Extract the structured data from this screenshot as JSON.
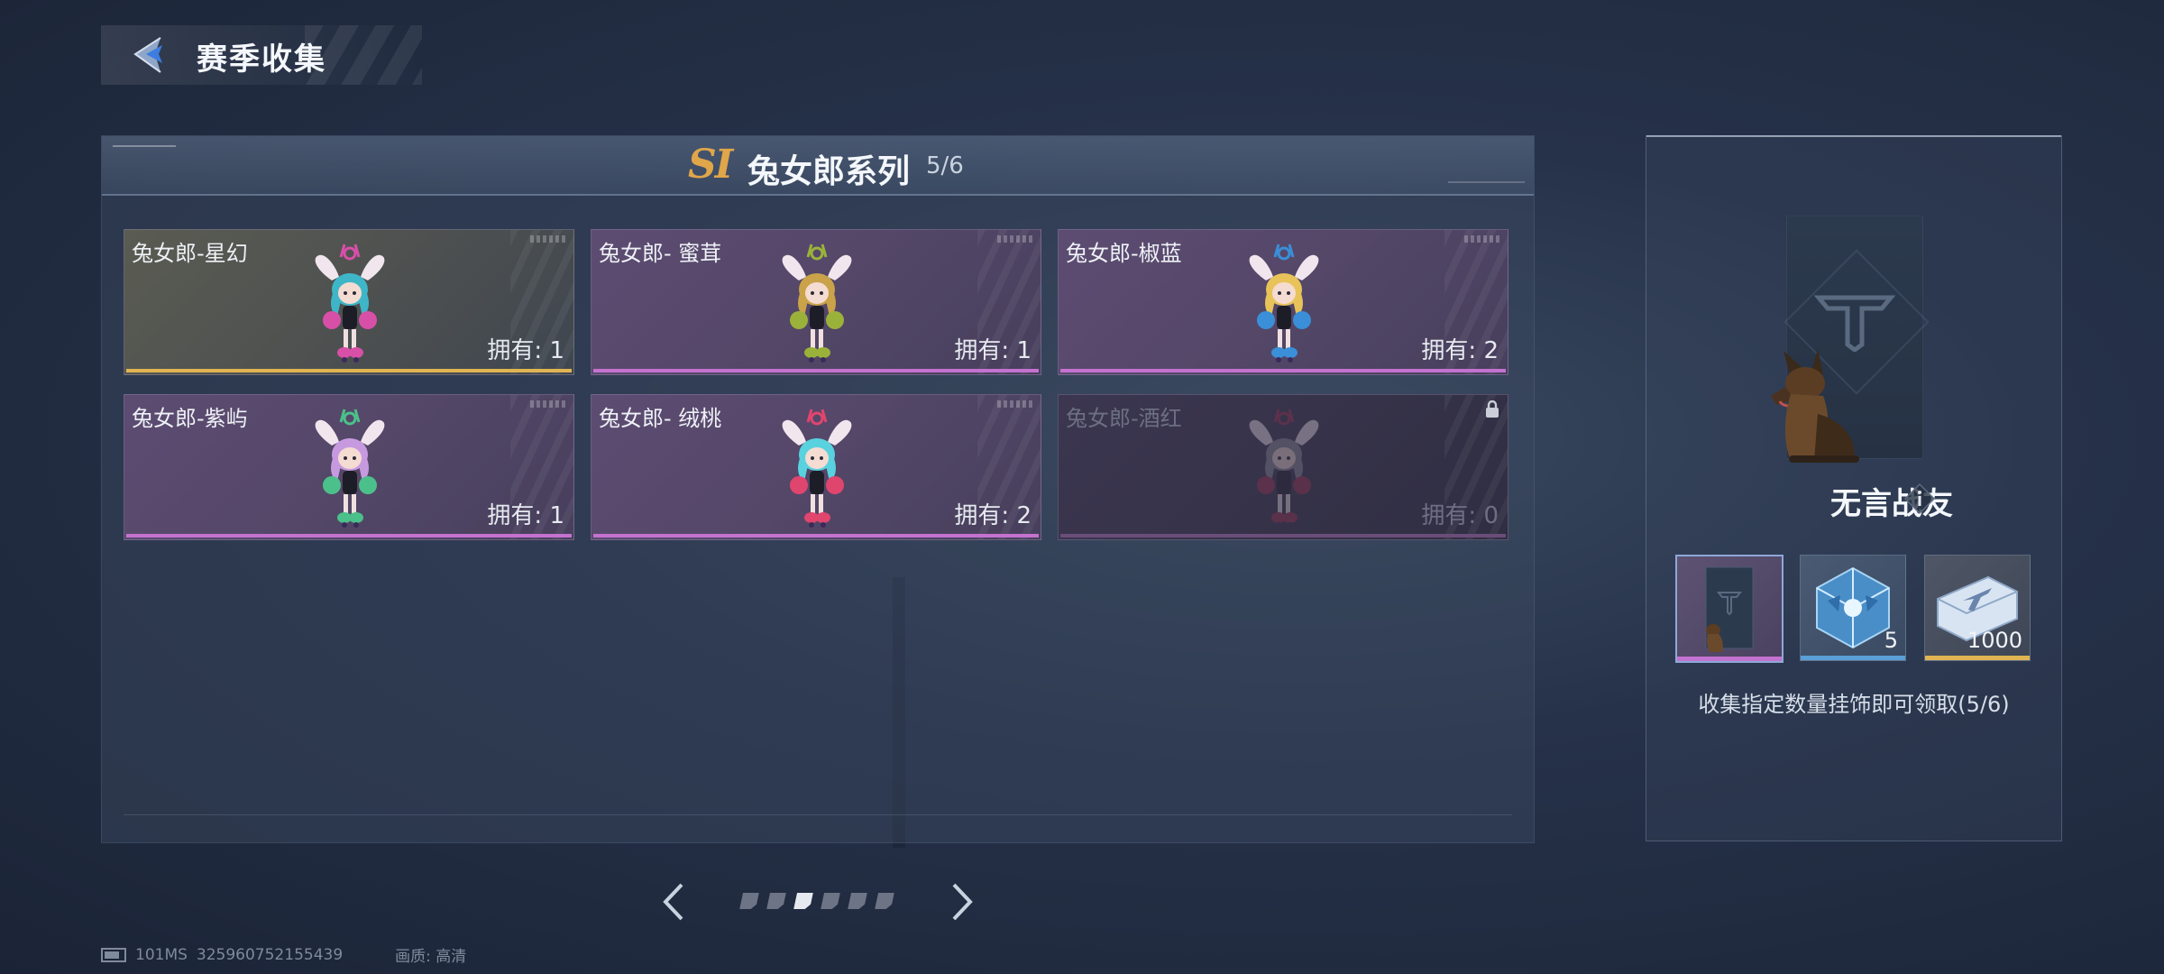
{
  "header": {
    "title": "赛季收集"
  },
  "series": {
    "season_badge": "SI",
    "name": "兔女郎系列",
    "progress": "5/6"
  },
  "cards": [
    {
      "name": "兔女郎-星幻",
      "owned": "拥有: 1",
      "hair": "#3fb6c8",
      "accent": "#d84fa8"
    },
    {
      "name": "兔女郎- 蜜茸",
      "owned": "拥有: 1",
      "hair": "#c9a24a",
      "accent": "#9bb23a"
    },
    {
      "name": "兔女郎-椒蓝",
      "owned": "拥有: 2",
      "hair": "#e8c35a",
      "accent": "#3a8fd8"
    },
    {
      "name": "兔女郎-紫屿",
      "owned": "拥有: 1",
      "hair": "#c79ae0",
      "accent": "#4cc08a"
    },
    {
      "name": "兔女郎- 绒桃",
      "owned": "拥有: 2",
      "hair": "#58d2df",
      "accent": "#e0456e"
    },
    {
      "name": "兔女郎-酒红",
      "owned": "拥有: 0",
      "hair": "#8a8a96",
      "accent": "#a03050",
      "locked": true
    }
  ],
  "reward": {
    "title": "无言战友",
    "items": [
      {
        "icon": "dog-card-icon",
        "count": ""
      },
      {
        "icon": "crystal-cube-icon",
        "count": "5"
      },
      {
        "icon": "ticket-icon",
        "count": "1000"
      }
    ],
    "description": "收集指定数量挂饰即可领取(5/6)"
  },
  "pager": {
    "pages": 6,
    "active_page": 3
  },
  "footer": {
    "ping": "101MS",
    "id": "325960752155439",
    "quality": "画质: 高清"
  },
  "colors": {
    "gold": "#e0b452",
    "purple": "#c472cf",
    "blue": "#5a9fd6"
  }
}
